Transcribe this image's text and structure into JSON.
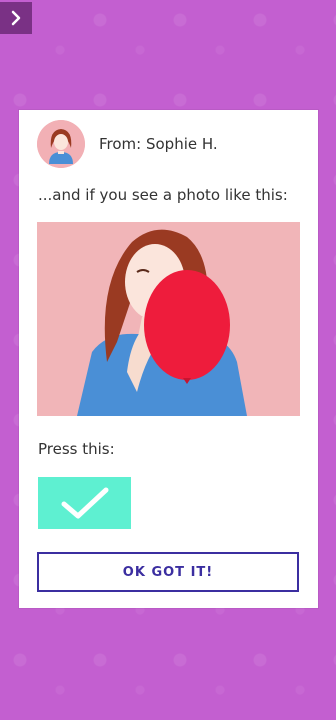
{
  "header": {
    "back_icon": "chevron-right-icon"
  },
  "card": {
    "from_label": "From: Sophie H.",
    "intro_text": "...and if you see a photo like this:",
    "press_text": "Press this:",
    "check_icon": "checkmark-icon",
    "ok_button_label": "OK GOT IT!"
  },
  "colors": {
    "background": "#c35fd0",
    "back_button": "#7a3185",
    "check_button": "#5ef0d1",
    "ok_button_border": "#3b2ea0",
    "balloon": "#ee1c3c",
    "photo_bg": "#f1b5b8"
  }
}
